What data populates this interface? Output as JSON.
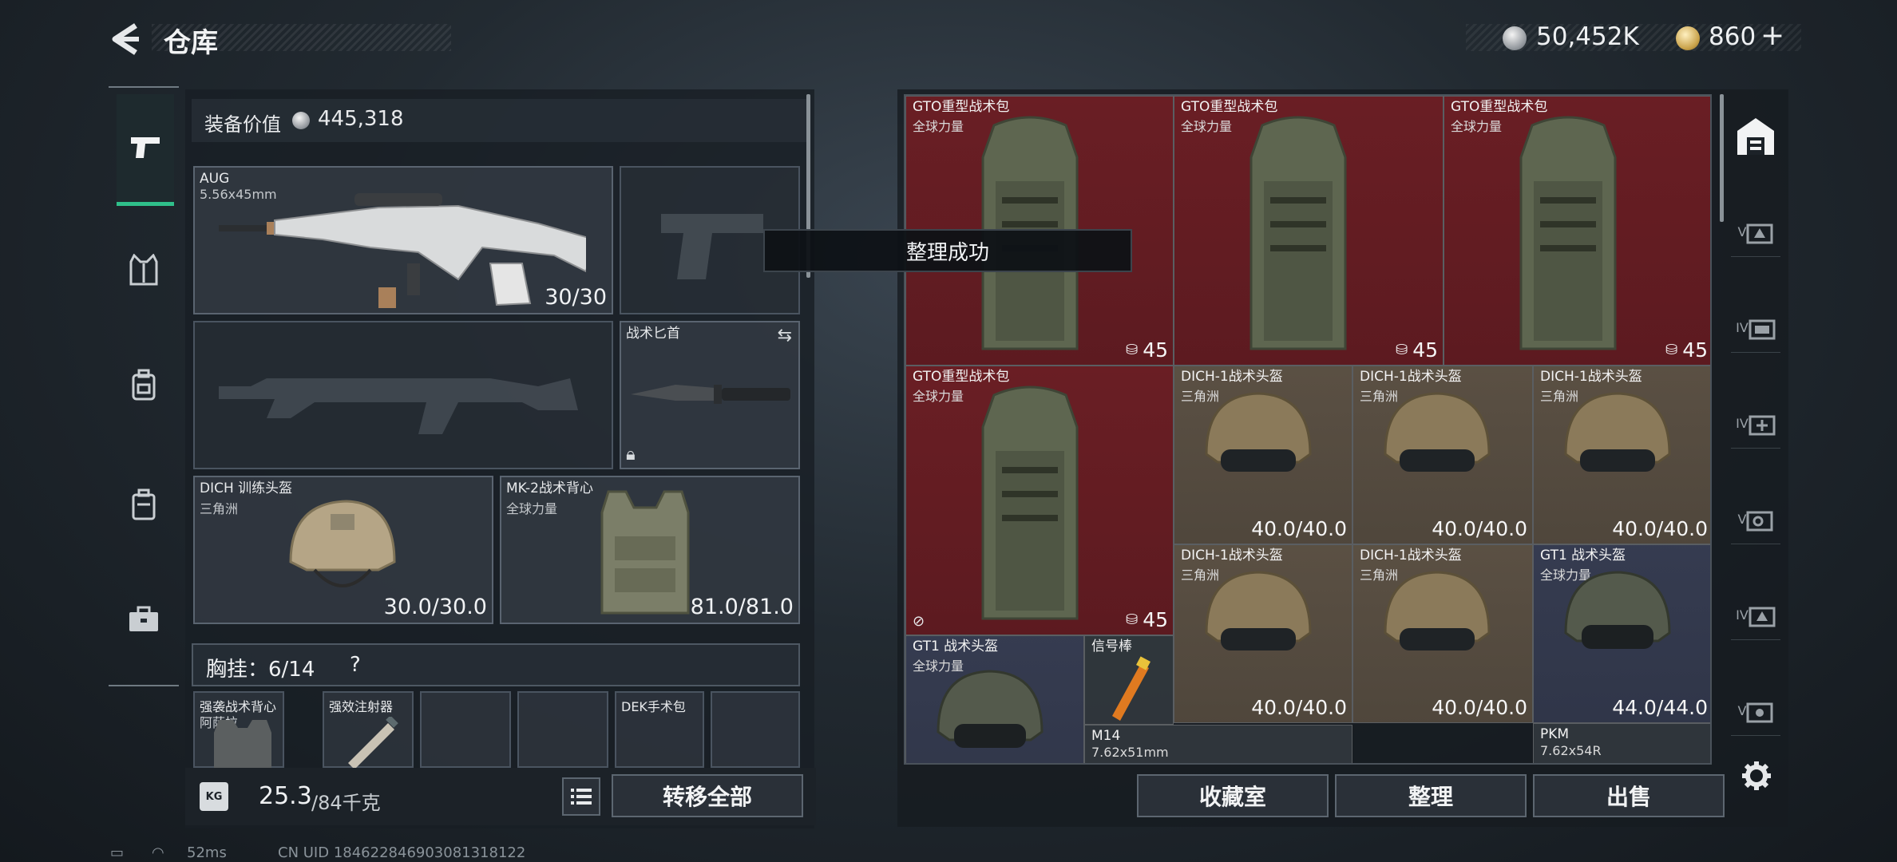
{
  "header": {
    "title": "仓库"
  },
  "currency": {
    "silver": "50,452K",
    "gold": "860",
    "gold_add": "+"
  },
  "left_panel": {
    "value_label": "装备价值",
    "value": "445,318",
    "primary_weapon": {
      "name": "AUG",
      "caliber": "5.56x45mm",
      "ammo": "30/30"
    },
    "melee": {
      "name": "战术匕首"
    },
    "helmet": {
      "name": "DICH 训练头盔",
      "brand": "三角洲",
      "durability": "30.0/30.0"
    },
    "armor": {
      "name": "MK-2战术背心",
      "brand": "全球力量",
      "durability": "81.0/81.0"
    },
    "chest_rig": {
      "label": "胸挂：6/14",
      "help": "?"
    },
    "rig_slots": [
      {
        "name": "强袭战术背心",
        "sub": "阿萨拉"
      },
      {
        "name": "强效注射器",
        "sub": ""
      },
      {
        "name": "",
        "sub": ""
      },
      {
        "name": "",
        "sub": ""
      },
      {
        "name": "DEK手术包",
        "sub": ""
      },
      {
        "name": "",
        "sub": ""
      }
    ],
    "weight": "25.3",
    "weight_max": "/84千克",
    "weight_icon": "KG",
    "transfer_all": "转移全部"
  },
  "toast": "整理成功",
  "grid": {
    "items": [
      {
        "name": "GTO重型战术包",
        "sub": "全球力量",
        "cap": "45",
        "color": "red"
      },
      {
        "name": "GTO重型战术包",
        "sub": "全球力量",
        "cap": "45",
        "color": "red"
      },
      {
        "name": "GTO重型战术包",
        "sub": "全球力量",
        "cap": "45",
        "color": "red"
      },
      {
        "name": "GTO重型战术包",
        "sub": "全球力量",
        "cap": "45",
        "color": "red"
      },
      {
        "name": "DICH-1战术头盔",
        "sub": "三角洲",
        "dur": "40.0/40.0",
        "color": "brown"
      },
      {
        "name": "DICH-1战术头盔",
        "sub": "三角洲",
        "dur": "40.0/40.0",
        "color": "brown"
      },
      {
        "name": "DICH-1战术头盔",
        "sub": "三角洲",
        "dur": "40.0/40.0",
        "color": "brown"
      },
      {
        "name": "DICH-1战术头盔",
        "sub": "三角洲",
        "dur": "40.0/40.0",
        "color": "brown"
      },
      {
        "name": "DICH-1战术头盔",
        "sub": "三角洲",
        "dur": "40.0/40.0",
        "color": "brown"
      },
      {
        "name": "GT1 战术头盔",
        "sub": "全球力量",
        "dur": "44.0/44.0",
        "color": "blue"
      },
      {
        "name": "GT1 战术头盔",
        "sub": "全球力量",
        "dur": "",
        "color": "blue"
      },
      {
        "name": "信号棒",
        "sub": "",
        "color": "grey"
      },
      {
        "name": "M14",
        "sub": "7.62x51mm",
        "color": "grey"
      },
      {
        "name": "PKM",
        "sub": "7.62x54R",
        "color": "grey"
      }
    ]
  },
  "actions": {
    "collection": "收藏室",
    "sort": "整理",
    "sell": "出售"
  },
  "right_nav": {
    "tabs": [
      "V",
      "IV",
      "IV",
      "V",
      "IV",
      "V"
    ]
  },
  "status_bar": {
    "ping": "52ms",
    "uid": "CN UID 1846228469030813181​22"
  }
}
